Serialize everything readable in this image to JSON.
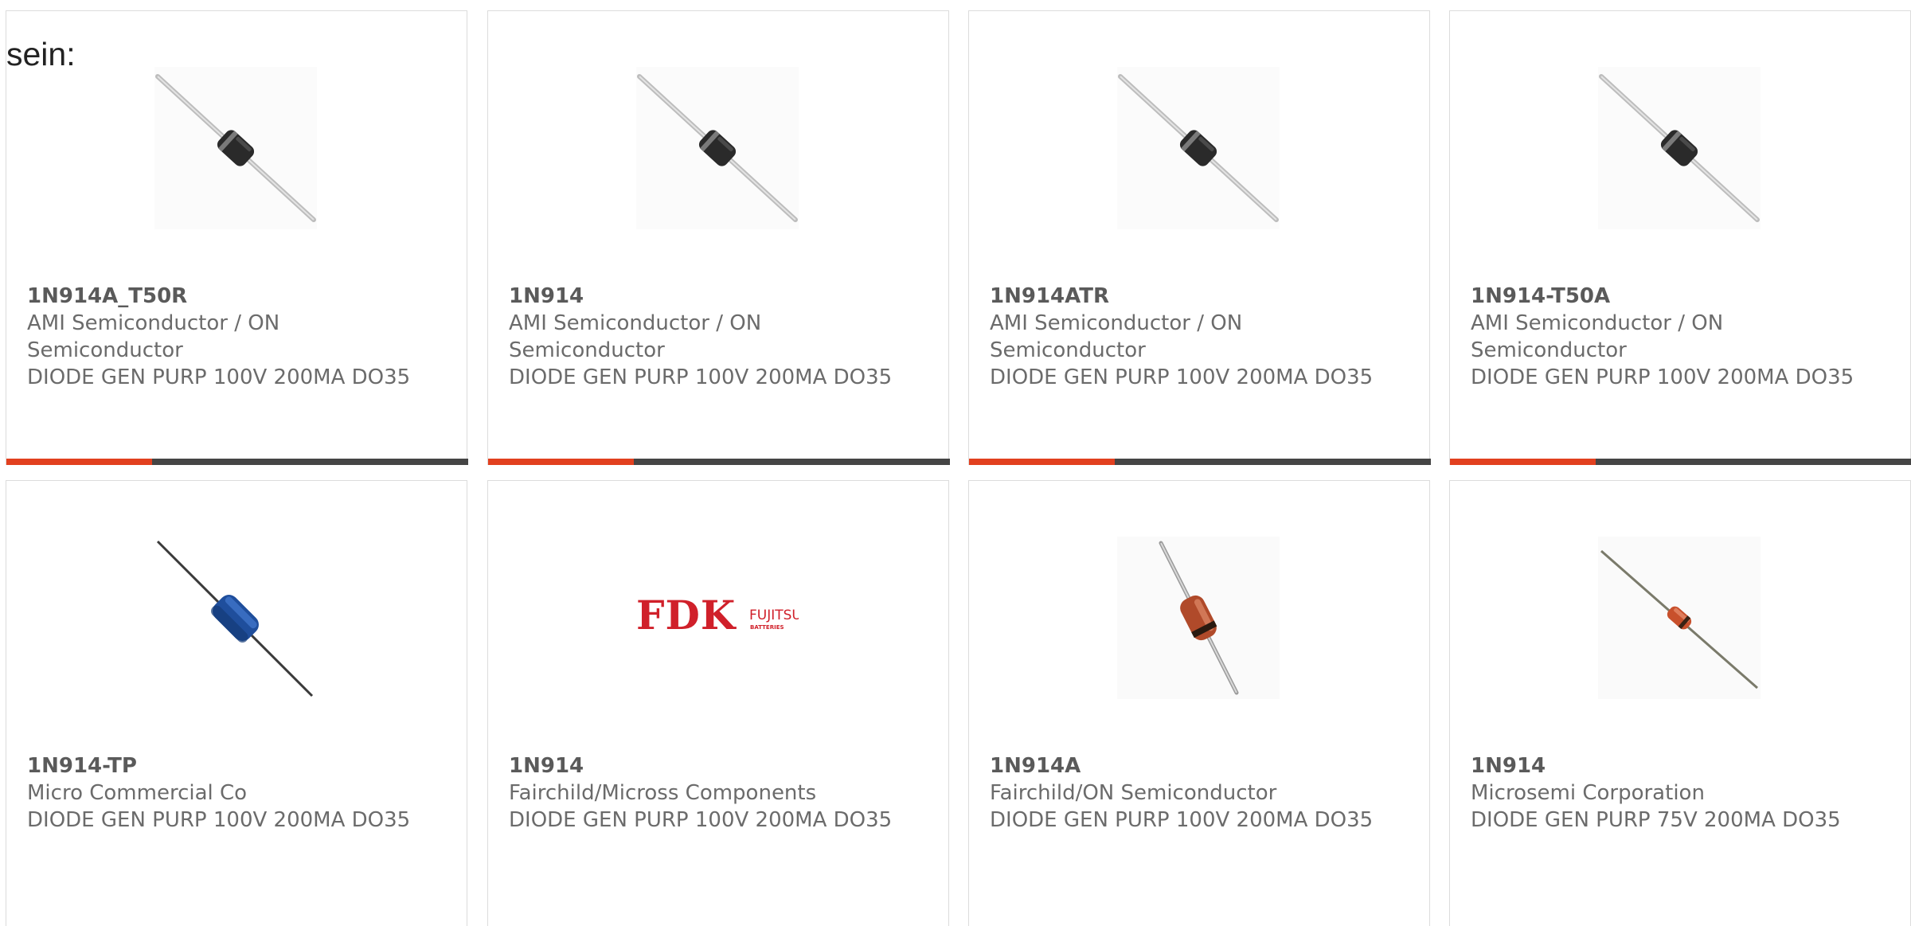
{
  "intro_text": "sein:",
  "accent_color": "#e2401f",
  "bar_color": "#454545",
  "products": [
    {
      "part": "1N914A_T50R",
      "manufacturer": "AMI Semiconductor / ON Semiconductor",
      "description": "DIODE GEN PURP 100V 200MA DO35",
      "image": "diode-black-icon"
    },
    {
      "part": "1N914",
      "manufacturer": "AMI Semiconductor / ON Semiconductor",
      "description": "DIODE GEN PURP 100V 200MA DO35",
      "image": "diode-black-icon"
    },
    {
      "part": "1N914ATR",
      "manufacturer": "AMI Semiconductor / ON Semiconductor",
      "description": "DIODE GEN PURP 100V 200MA DO35",
      "image": "diode-black-icon"
    },
    {
      "part": "1N914-T50A",
      "manufacturer": "AMI Semiconductor / ON Semiconductor",
      "description": "DIODE GEN PURP 100V 200MA DO35",
      "image": "diode-black-icon"
    },
    {
      "part": "1N914-TP",
      "manufacturer": "Micro Commercial Co",
      "description": "DIODE GEN PURP 100V 200MA DO35",
      "image": "diode-blue-icon"
    },
    {
      "part": "1N914",
      "manufacturer": "Fairchild/Micross Components",
      "description": "DIODE GEN PURP 100V 200MA DO35",
      "image": "fdk-fujitsu-logo",
      "logo_text": {
        "brand": "FDK",
        "sub": "FUJITSU",
        "tag": "BATTERIES"
      }
    },
    {
      "part": "1N914A",
      "manufacturer": "Fairchild/ON Semiconductor",
      "description": "DIODE GEN PURP 100V 200MA DO35",
      "image": "diode-glass-icon"
    },
    {
      "part": "1N914",
      "manufacturer": "Microsemi Corporation",
      "description": "DIODE GEN PURP 75V 200MA DO35",
      "image": "diode-glass-small-icon"
    }
  ]
}
